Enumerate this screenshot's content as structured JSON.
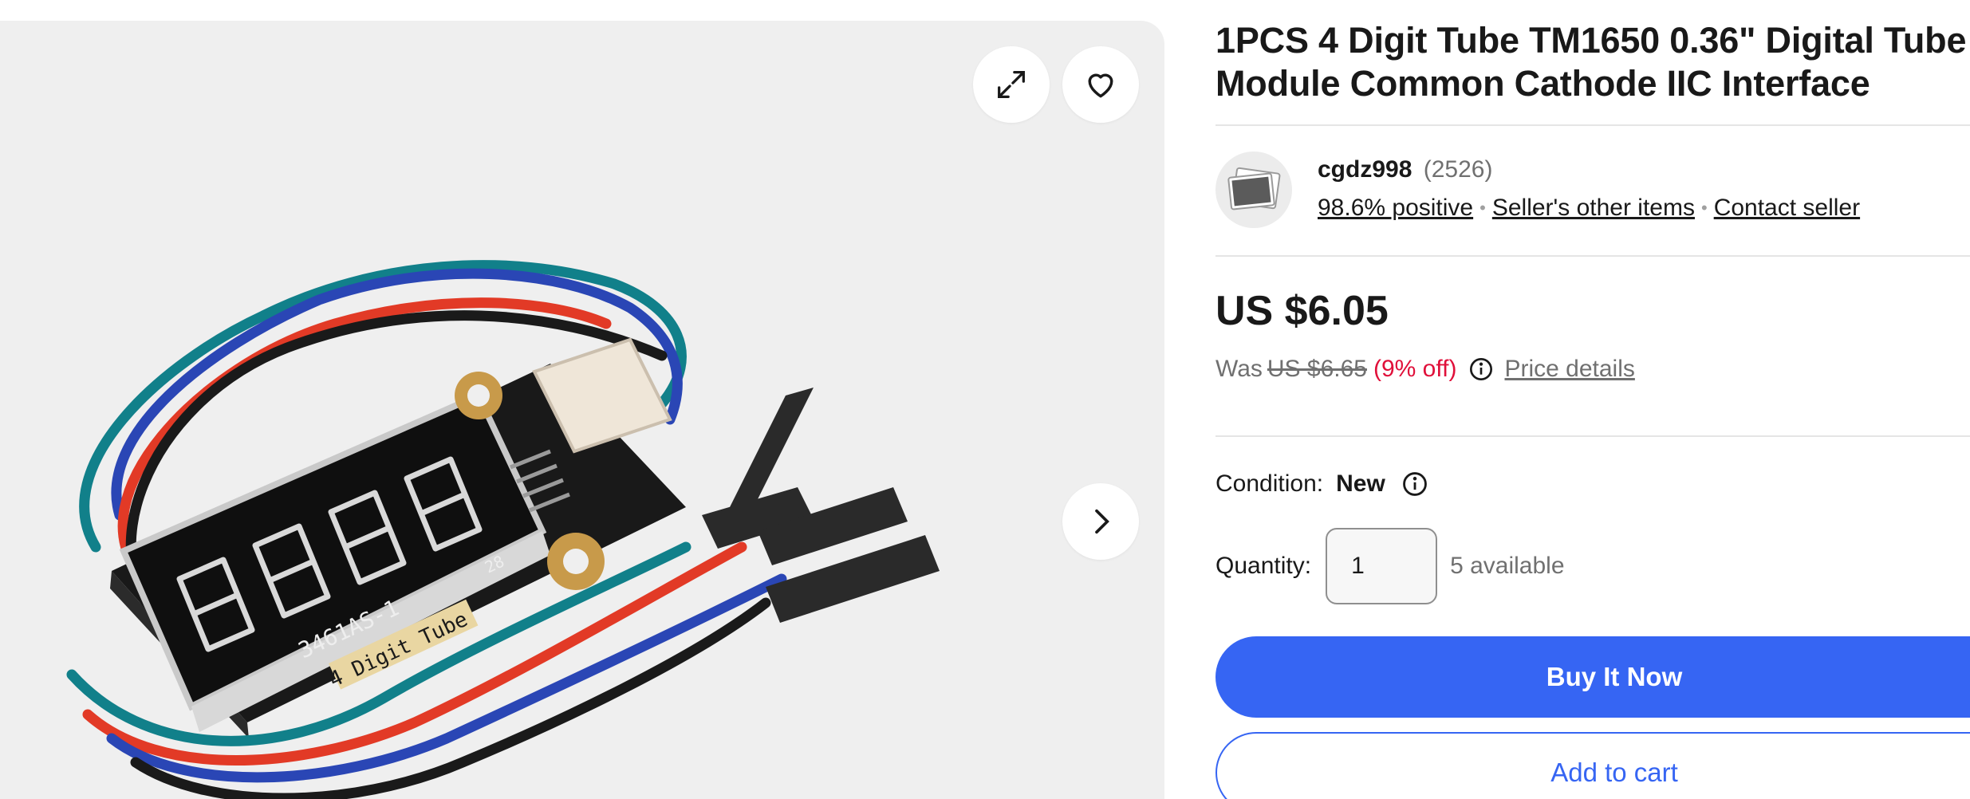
{
  "gallery": {
    "expand_icon": "expand-icon",
    "watch_icon": "heart-icon",
    "next_icon": "chevron-right-icon",
    "image": {
      "board_print": "3461AS-1",
      "board_label": "4 Digit Tube",
      "board_number": "28"
    }
  },
  "listing": {
    "title_line1": "1PCS 4 Digit Tube TM1650 0.36\" Digital Tube",
    "title_line2": "Module Common Cathode IIC Interface"
  },
  "seller": {
    "name": "cgdz998",
    "feedback_count": "(2526)",
    "positive": "98.6% positive",
    "other_items": "Seller's other items",
    "contact": "Contact seller"
  },
  "pricing": {
    "price": "US $6.05",
    "was_label": "Was",
    "was_price": "US $6.65",
    "discount": "(9% off)",
    "details_link": "Price details"
  },
  "condition": {
    "label": "Condition:",
    "value": "New"
  },
  "quantity": {
    "label": "Quantity:",
    "value": "1",
    "available": "5 available"
  },
  "actions": {
    "buy_now": "Buy It Now",
    "add_to_cart": "Add to cart"
  },
  "colors": {
    "accent": "#3665f3",
    "discount": "#e0103a",
    "muted_text": "#707070"
  }
}
